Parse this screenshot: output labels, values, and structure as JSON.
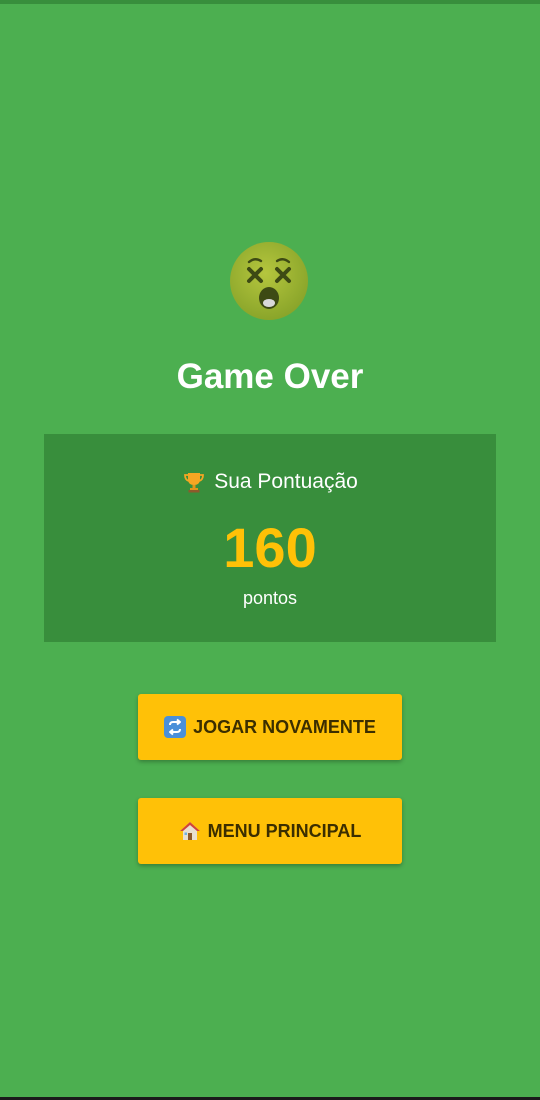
{
  "screen": {
    "title": "Game Over",
    "face_icon": "dizzy-face-icon",
    "background_color": "#4caf50"
  },
  "score": {
    "label": "Sua Pontuação",
    "label_icon": "trophy-icon",
    "value": "160",
    "unit": "pontos",
    "card_color": "#388e3c",
    "value_color": "#ffc107"
  },
  "actions": {
    "play_again_label": "JOGAR NOVAMENTE",
    "play_again_icon": "repeat-arrows-icon",
    "main_menu_label": "MENU PRINCIPAL",
    "main_menu_icon": "house-icon",
    "button_color": "#ffc107"
  }
}
